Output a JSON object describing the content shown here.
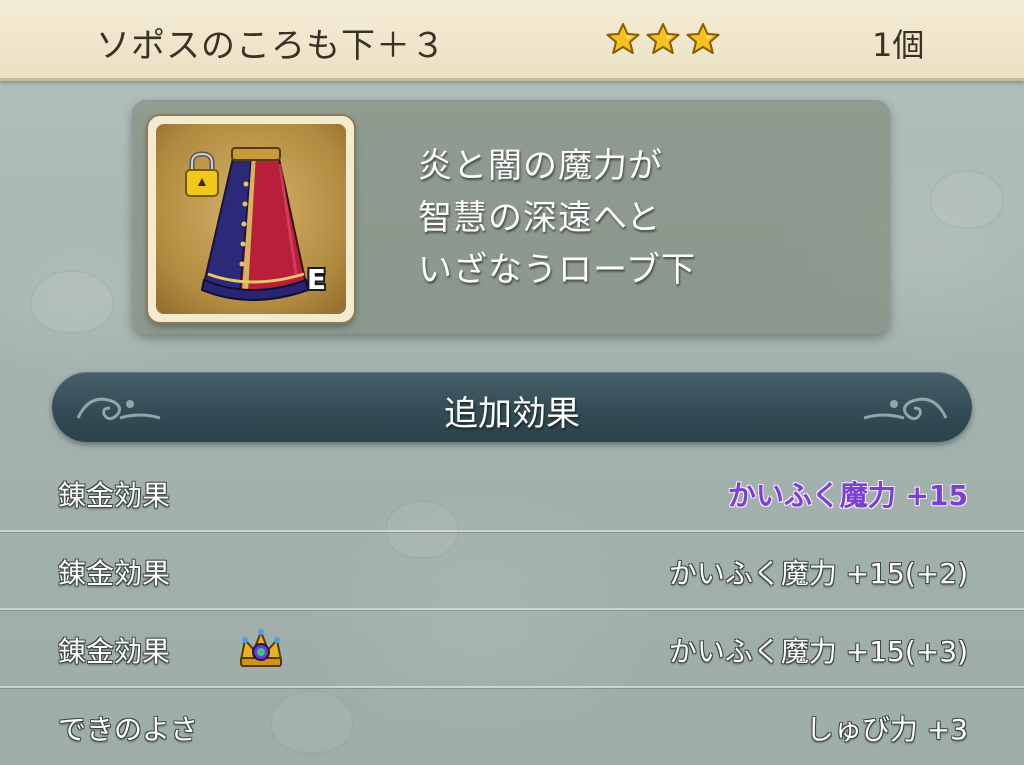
{
  "item": {
    "name": "ソポスのころも下＋３",
    "stars": 3,
    "count": "1個",
    "equipped_label": "E",
    "icon": "robe-bottom-icon",
    "locked": true
  },
  "description": {
    "lines": [
      "炎と闇の魔力が",
      "智慧の深遠へと",
      "いざなうローブ下"
    ]
  },
  "section": {
    "title": "追加効果"
  },
  "rows": [
    {
      "label": "錬金効果",
      "value": "かいふく魔力  +15",
      "highlight": true
    },
    {
      "label": "錬金効果",
      "value": "かいふく魔力  +15(+2)",
      "highlight": false
    },
    {
      "label": "錬金効果",
      "value": "かいふく魔力  +15(+3)",
      "highlight": false,
      "icon": "crown-icon"
    },
    {
      "label": "できのよさ",
      "value": "しゅび力  +3",
      "highlight": false
    }
  ],
  "colors": {
    "header_bg": "#f4ecd6",
    "star": "#f3c21c",
    "banner": "#344c56",
    "highlight_text": "#7a3fd6"
  }
}
